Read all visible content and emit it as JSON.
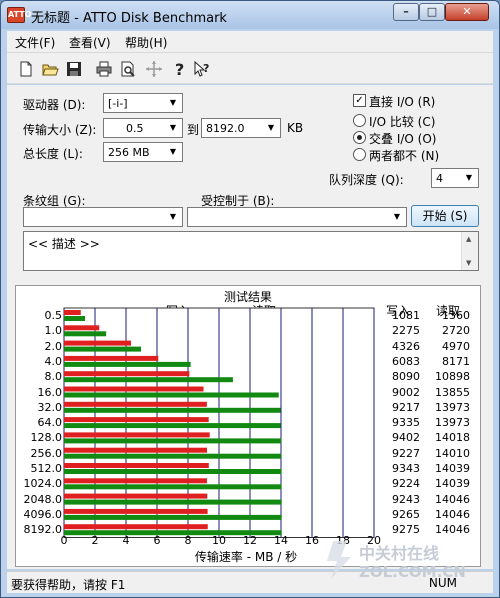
{
  "window": {
    "title": "无标题 - ATTO Disk Benchmark",
    "icon_label": "ATTO"
  },
  "menu": {
    "items": [
      "文件(F)",
      "查看(V)",
      "帮助(H)"
    ]
  },
  "toolbar": {
    "icons": [
      "new-file-icon",
      "open-folder-icon",
      "save-icon",
      "print-icon",
      "print-preview-icon",
      "move-icon",
      "help-icon",
      "context-help-icon"
    ]
  },
  "form": {
    "drive_label": "驱动器 (D):",
    "drive_value": "[-i-]",
    "transfer_label": "传输大小 (Z):",
    "transfer_from": "0.5",
    "to_label": "到",
    "transfer_to": "8192.0",
    "kb_label": "KB",
    "total_label": "总长度 (L):",
    "total_value": "256 MB",
    "direct_io_label": "直接 I/O (R)",
    "direct_io_checked": true,
    "radio_options": [
      {
        "label": "I/O 比较 (C)",
        "selected": false
      },
      {
        "label": "交叠 I/O (O)",
        "selected": true
      },
      {
        "label": "两者都不 (N)",
        "selected": false
      }
    ],
    "queue_label": "队列深度 (Q):",
    "queue_value": "4",
    "stripe_label": "条纹组 (G):",
    "stripe_value": "",
    "controlled_label": "受控制于 (B):",
    "controlled_value": "",
    "start_label": "开始 (S)",
    "description": "<< 描述 >>"
  },
  "results": {
    "title": "测试结果",
    "write_label": "写入",
    "read_label": "读取",
    "write_col": "写入",
    "read_col": "读取",
    "x_title": "传输速率 - MB / 秒"
  },
  "chart_data": {
    "type": "bar",
    "orientation": "horizontal",
    "title": "测试结果",
    "xlabel": "传输速率 - MB / 秒",
    "categories": [
      "0.5",
      "1.0",
      "2.0",
      "4.0",
      "8.0",
      "16.0",
      "32.0",
      "64.0",
      "128.0",
      "256.0",
      "512.0",
      "1024.0",
      "2048.0",
      "4096.0",
      "8192.0"
    ],
    "xticks": [
      "0",
      "2",
      "4",
      "6",
      "8",
      "10",
      "12",
      "14",
      "16",
      "18",
      "20"
    ],
    "xlim": [
      0,
      20
    ],
    "grid": true,
    "series": [
      {
        "name": "写入",
        "color": "#e02020",
        "values": [
          1081,
          2275,
          4326,
          6083,
          8090,
          9002,
          9217,
          9335,
          9402,
          9227,
          9343,
          9224,
          9243,
          9265,
          9275
        ]
      },
      {
        "name": "读取",
        "color": "#128a12",
        "values": [
          1360,
          2720,
          4970,
          8171,
          10898,
          13855,
          13973,
          13973,
          14018,
          14010,
          14039,
          14039,
          14046,
          14046,
          14046
        ]
      }
    ]
  },
  "status": {
    "help_text": "要获得帮助，请按 F1",
    "num_indicator": "NUM"
  },
  "watermark": {
    "text_cn": "中关村在线",
    "text_en": "ZOL.COM.CN"
  },
  "colors": {
    "write": "#e02020",
    "read": "#128a12",
    "titlebar": "#bcd1ea"
  }
}
